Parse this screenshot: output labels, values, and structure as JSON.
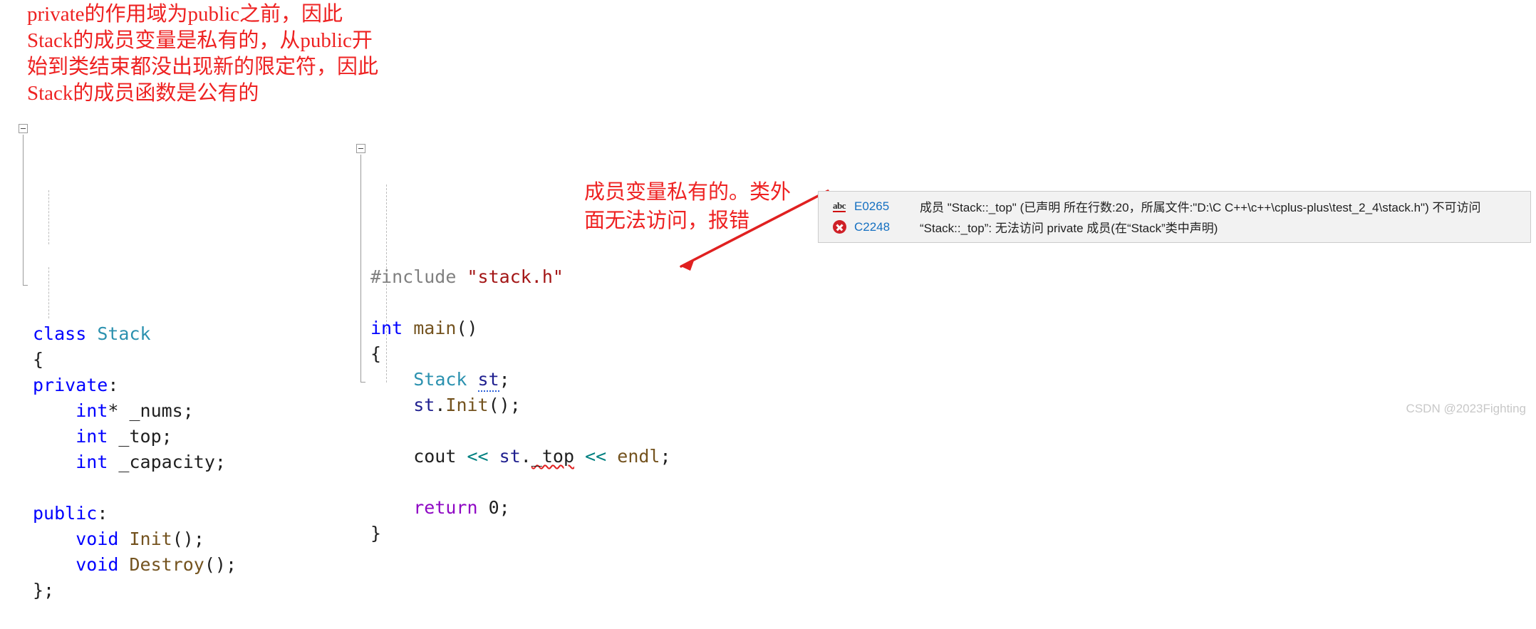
{
  "annotations": {
    "top": "private的作用域为public之前，因此\nStack的成员变量是私有的，从public开\n始到类结束都没出现新的限定符，因此\nStack的成员函数是公有的",
    "middle": "成员变量私有的。类外\n面无法访问，报错"
  },
  "code_left": {
    "lines": [
      {
        "tokens": [
          {
            "t": "class",
            "c": "kw"
          },
          {
            "t": " ",
            "c": "plain"
          },
          {
            "t": "Stack",
            "c": "type"
          }
        ]
      },
      {
        "tokens": [
          {
            "t": "{",
            "c": "plain"
          }
        ]
      },
      {
        "tokens": [
          {
            "t": "private",
            "c": "kw"
          },
          {
            "t": ":",
            "c": "plain"
          }
        ]
      },
      {
        "tokens": [
          {
            "t": "    ",
            "c": "plain"
          },
          {
            "t": "int",
            "c": "kw"
          },
          {
            "t": "* _nums;",
            "c": "plain"
          }
        ]
      },
      {
        "tokens": [
          {
            "t": "    ",
            "c": "plain"
          },
          {
            "t": "int",
            "c": "kw"
          },
          {
            "t": " _top;",
            "c": "plain"
          }
        ]
      },
      {
        "tokens": [
          {
            "t": "    ",
            "c": "plain"
          },
          {
            "t": "int",
            "c": "kw"
          },
          {
            "t": " _capacity;",
            "c": "plain"
          }
        ]
      },
      {
        "tokens": []
      },
      {
        "tokens": [
          {
            "t": "public",
            "c": "kw"
          },
          {
            "t": ":",
            "c": "plain"
          }
        ]
      },
      {
        "tokens": [
          {
            "t": "    ",
            "c": "plain"
          },
          {
            "t": "void",
            "c": "kw"
          },
          {
            "t": " ",
            "c": "plain"
          },
          {
            "t": "Init",
            "c": "fn"
          },
          {
            "t": "();",
            "c": "plain"
          }
        ]
      },
      {
        "tokens": [
          {
            "t": "    ",
            "c": "plain"
          },
          {
            "t": "void",
            "c": "kw"
          },
          {
            "t": " ",
            "c": "plain"
          },
          {
            "t": "Destroy",
            "c": "fn"
          },
          {
            "t": "();",
            "c": "plain"
          }
        ]
      },
      {
        "tokens": [
          {
            "t": "};",
            "c": "plain"
          }
        ]
      }
    ]
  },
  "code_right": {
    "lines": [
      {
        "tokens": [
          {
            "t": "#include",
            "c": "pp"
          },
          {
            "t": " ",
            "c": "plain"
          },
          {
            "t": "\"stack.h\"",
            "c": "str"
          }
        ]
      },
      {
        "tokens": []
      },
      {
        "tokens": [
          {
            "t": "int",
            "c": "kw"
          },
          {
            "t": " ",
            "c": "plain"
          },
          {
            "t": "main",
            "c": "fn"
          },
          {
            "t": "()",
            "c": "plain"
          }
        ]
      },
      {
        "tokens": [
          {
            "t": "{",
            "c": "plain"
          }
        ]
      },
      {
        "tokens": [
          {
            "t": "    ",
            "c": "plain"
          },
          {
            "t": "Stack",
            "c": "type"
          },
          {
            "t": " ",
            "c": "plain"
          },
          {
            "t": "st",
            "c": "var u-dot"
          },
          {
            "t": ";",
            "c": "plain"
          }
        ]
      },
      {
        "tokens": [
          {
            "t": "    ",
            "c": "plain"
          },
          {
            "t": "st",
            "c": "var"
          },
          {
            "t": ".",
            "c": "plain"
          },
          {
            "t": "Init",
            "c": "fn"
          },
          {
            "t": "();",
            "c": "plain"
          }
        ]
      },
      {
        "tokens": []
      },
      {
        "tokens": [
          {
            "t": "    cout ",
            "c": "plain"
          },
          {
            "t": "<<",
            "c": "op"
          },
          {
            "t": " ",
            "c": "plain"
          },
          {
            "t": "st",
            "c": "var"
          },
          {
            "t": ".",
            "c": "plain"
          },
          {
            "t": "_top",
            "c": "plain u-sq"
          },
          {
            "t": " ",
            "c": "plain"
          },
          {
            "t": "<<",
            "c": "op"
          },
          {
            "t": " ",
            "c": "plain"
          },
          {
            "t": "endl",
            "c": "fn"
          },
          {
            "t": ";",
            "c": "plain"
          }
        ]
      },
      {
        "tokens": []
      },
      {
        "tokens": [
          {
            "t": "    ",
            "c": "plain"
          },
          {
            "t": "return",
            "c": "ctrl"
          },
          {
            "t": " 0;",
            "c": "plain"
          }
        ]
      },
      {
        "tokens": [
          {
            "t": "}",
            "c": "plain"
          }
        ]
      }
    ]
  },
  "error_tooltip": {
    "rows": [
      {
        "icon": "intellisense-abc-icon",
        "icon_label": "abc",
        "code": "E0265",
        "message": "成员 \"Stack::_top\" (已声明 所在行数:20，所属文件:\"D:\\C C++\\c++\\cplus-plus\\test_2_4\\stack.h\") 不可访问"
      },
      {
        "icon": "error-x-icon",
        "icon_label": "",
        "code": "C2248",
        "message": "“Stack::_top”: 无法访问 private 成员(在“Stack”类中声明)"
      }
    ]
  },
  "watermark": "CSDN @2023Fighting",
  "colors": {
    "annotation_red": "#ee2222",
    "keyword_blue": "#0000ff",
    "type_teal": "#2b91af",
    "function_brown": "#74531f",
    "control_purple": "#8f08c4",
    "preprocessor_gray": "#808080",
    "string_darkred": "#a31515",
    "operator_teal": "#008080",
    "error_code_blue": "#1570c1",
    "error_icon_red": "#cf2027",
    "tooltip_background": "#f2f2f2",
    "squiggle_red": "#e02020"
  }
}
